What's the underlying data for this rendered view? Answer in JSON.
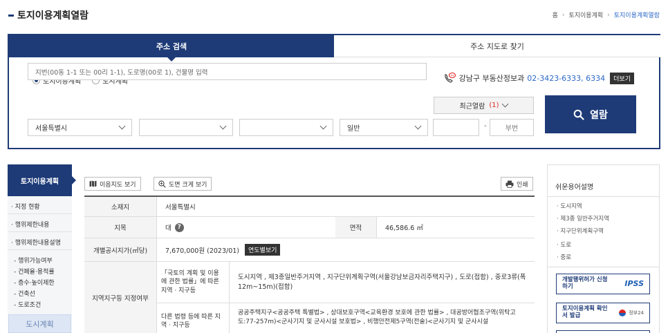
{
  "header": {
    "title": "토지이용계획열람",
    "breadcrumb": [
      "홈",
      "토지이용계획",
      "토지이용계획열람"
    ]
  },
  "search": {
    "tabs": [
      "주소 검색",
      "주소 지도로 찾기"
    ],
    "radios": [
      {
        "label": "토지이용계획",
        "selected": true
      },
      {
        "label": "도시계획",
        "selected": false
      }
    ],
    "contact": {
      "district": "강남구 부동산정보과",
      "phone": "02-3423-6333, 6334",
      "count": "(1)",
      "more": "더보기"
    },
    "address_placeholder": "지번(00동 1-1 또는 00리 1-1), 도로명(00로 1), 건물명 입력",
    "recent_label": "최근열람",
    "recent_count": "(1)",
    "submit_label": "열람",
    "selects": [
      "서울특별시",
      "",
      "",
      "일반"
    ],
    "bunji_placeholder": "부번",
    "dash": "-"
  },
  "left_menu": {
    "title": "토지이용계획",
    "items": [
      "지정 현황",
      "행위제한내용",
      "행위제한내용설명"
    ],
    "subitems": [
      "행위가능여부",
      "건폐율·용적률",
      "층수·높이제한",
      "건축선",
      "도로조건"
    ],
    "bottom": "도시계획"
  },
  "toolbar": {
    "map_view": "이음지도 보기",
    "zoom_view": "도면 크게 보기",
    "print": "인쇄"
  },
  "table": {
    "location_head": "소재지",
    "location": "서울특별시",
    "jimok_head": "지목",
    "jimok": "대",
    "area_head": "면적",
    "area": "46,586.6 ㎡",
    "price_head": "개별공시지가(㎡당)",
    "price": "7,670,000원 (2023/01)",
    "price_btn": "연도별보기",
    "zone_head": "지역지구등 지정여부",
    "law1_head": "「국토의 계획 및 이용에 관한 법률」에 따른 지역 · 지구등",
    "law1_value": "도시지역 , 제3종일반주거지역 , 지구단위계획구역(서울강남보금자리주택지구) , 도로(접함) , 중로3류(폭 12m~15m)(접함)",
    "law2_head": "다른 법령 등에 따른 지역 · 지구등",
    "law2_value": "공공주택지구<공공주택 특별법> , 상대보호구역<교육환경 보호에 관한 법률> , 대공방어협조구역(위탁고도:77-257m)<군사기지 및 군사시설 보호법> , 비행안전제5구역(전술)<군사기지 및 군사시설"
  },
  "right_panel": {
    "title": "쉬운용어설명",
    "items": [
      "도시지역",
      "제3종 일반주거지역",
      "지구단위계획구역",
      "도로",
      "중로"
    ],
    "box1_label": "개발행위허가 신청하기",
    "box1_logo": "IPSS",
    "box2_label": "토지이용계획 확인서 발급",
    "box2_logo": "정부24"
  }
}
